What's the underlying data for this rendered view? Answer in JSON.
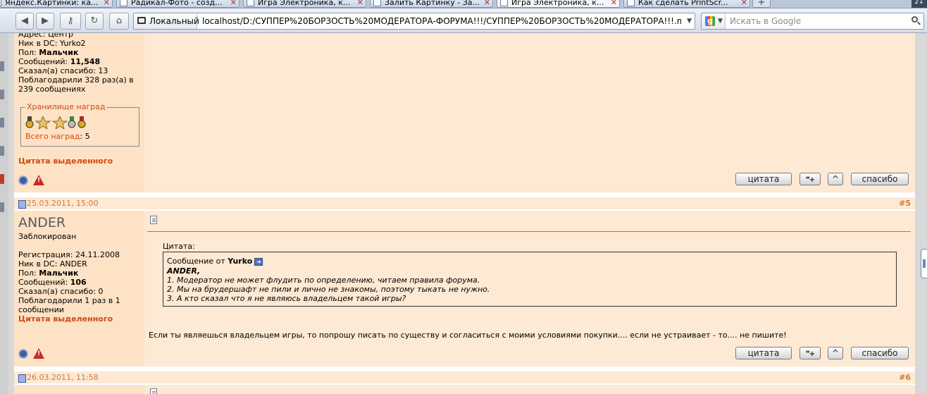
{
  "browser": {
    "tabs": [
      {
        "label": "Яндекс.Картинки: ка...",
        "active": false
      },
      {
        "label": "Радикал-Фото - созд...",
        "active": false
      },
      {
        "label": "Игра Электроника, к...",
        "active": false
      },
      {
        "label": "Залить Картинку - За...",
        "active": false
      },
      {
        "label": "Игра Электроника, к...",
        "active": true
      },
      {
        "label": "Как сделать PrintScr...",
        "active": false
      }
    ],
    "new_tab": "+",
    "tab_menu": "2↓",
    "nav": {
      "back": "◀",
      "forward": "▶",
      "key": "⚷",
      "reload": "↻",
      "home": "⌂"
    },
    "site_identity": "Локальный",
    "url": "localhost/D:/СУППЕР%20БОРЗОСТЬ%20МОДЕРАТОРА-ФОРУМА!!!/СУППЕР%20БОРЗОСТЬ%20МОДЕРАТОРА!!!.mht",
    "search_placeholder": "Искать в Google",
    "search_engine_letter": "g"
  },
  "post4": {
    "address": "Адрес: Центр",
    "dc_nick": "Ник в DC: Yurko2",
    "gender_label": "Пол: ",
    "gender_value": "Мальчик",
    "messages_label": "Сообщений: ",
    "messages_value": "11,548",
    "thanked": "Сказал(а) спасибо: 13",
    "thanked_by_line1": "Поблагодарили 328 раз(а) в",
    "thanked_by_line2": "239 сообщениях",
    "awards_title": "Хранилище наград",
    "awards_total_label": "Всего наград",
    "awards_total_value": ": 5",
    "quote_selected": "Цитата выделенного"
  },
  "post5": {
    "date": "25.03.2011, 15:00",
    "number": "#5",
    "username": "ANDER",
    "status": "Заблокирован",
    "registration": "Регистрация: 24.11.2008",
    "dc_nick": "Ник в DC: ANDER",
    "gender_label": "Пол: ",
    "gender_value": "Мальчик",
    "messages_label": "Сообщений: ",
    "messages_value": "106",
    "thanked": "Сказал(а) спасибо: 0",
    "thanked_by_line1": "Поблагодарили 1 раз в 1",
    "thanked_by_line2": "сообщении",
    "quote_selected": "Цитата выделенного",
    "quote_label": "Цитата:",
    "quote_from_prefix": "Сообщение от ",
    "quote_author": "Yurko",
    "quote_lines": [
      "ANDER,",
      "1. Модератор не может флудить по определению, читаем правила форума.",
      "2. Мы на брудершафт не пили и лично не знакомы, поэтому тыкать не нужно.",
      "3. А кто сказал что я не являюсь владельцем такой игры?"
    ],
    "message": "Если ты являешься владельцем игры, то попрошу писать по существу и согласиться с моими условиями покупки.... если не устраивает - то.... не пишите!"
  },
  "post6": {
    "date": "26.03.2011, 11:58",
    "number": "#6"
  },
  "buttons": {
    "quote": "цитата",
    "multiquote": "❞+",
    "up": "^",
    "thanks": "спасибо"
  },
  "colors": {
    "post_bg": "#fde9d4",
    "userinfo_bg": "#fde2c6",
    "accent_red": "#d24a10",
    "date_orange": "#d07a3a"
  }
}
